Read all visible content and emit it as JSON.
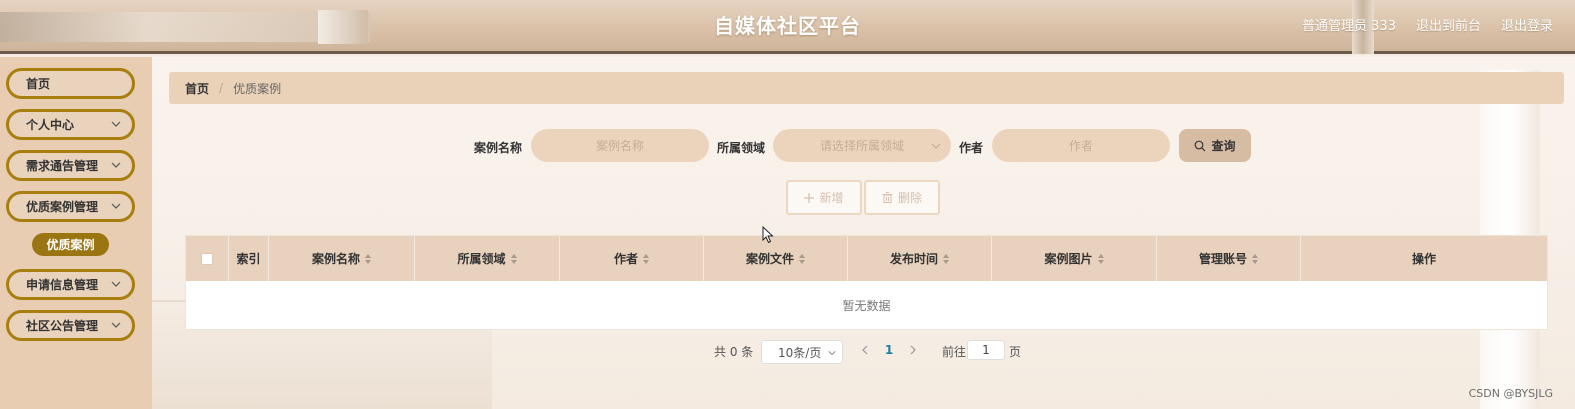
{
  "header": {
    "title": "自媒体社区平台",
    "user_label": "普通管理员 333",
    "back_to_front": "退出到前台",
    "logout": "退出登录"
  },
  "sidebar": {
    "items": [
      {
        "label": "首页",
        "has_children": false
      },
      {
        "label": "个人中心",
        "has_children": true
      },
      {
        "label": "需求通告管理",
        "has_children": true
      },
      {
        "label": "优质案例管理",
        "has_children": true,
        "expanded": true
      },
      {
        "label": "申请信息管理",
        "has_children": true
      },
      {
        "label": "社区公告管理",
        "has_children": true
      }
    ],
    "active_sub_item": "优质案例"
  },
  "breadcrumb": {
    "home": "首页",
    "separator": "/",
    "current": "优质案例"
  },
  "search": {
    "name_label": "案例名称",
    "name_placeholder": "案例名称",
    "domain_label": "所属领域",
    "domain_placeholder": "请选择所属领域",
    "author_label": "作者",
    "author_placeholder": "作者",
    "query_button": "查询"
  },
  "actions": {
    "add": "新增",
    "delete": "删除"
  },
  "table": {
    "columns": [
      "索引",
      "案例名称",
      "所属领域",
      "作者",
      "案例文件",
      "发布时间",
      "案例图片",
      "管理账号",
      "操作"
    ],
    "empty_text": "暂无数据"
  },
  "pagination": {
    "total": "共 0 条",
    "page_size": "10条/页",
    "current_page": "1",
    "goto_label": "前往",
    "goto_value": "1",
    "page_suffix": "页"
  },
  "watermark": "CSDN @BYSJLG",
  "colors": {
    "accent_border": "#a87f0e",
    "active_sub_bg": "#9a7512",
    "header_bg": "#d9c0a6",
    "pill_bg": "#ecd4bc",
    "page_number": "#1b7fa6"
  }
}
